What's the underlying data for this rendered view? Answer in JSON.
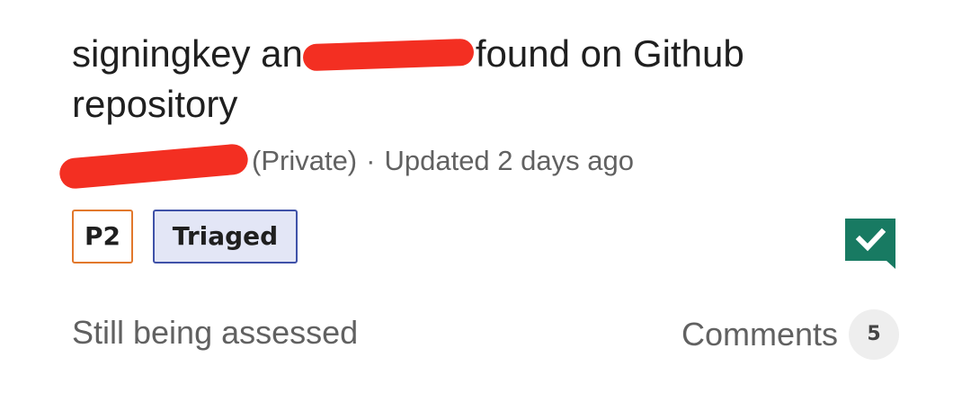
{
  "issue": {
    "title_start": "signingkey an",
    "title_end": "found on Github repository",
    "visibility": "(Private)",
    "separator": "·",
    "updated": "Updated 2 days ago",
    "priority": "P2",
    "status": "Triaged",
    "status_icon": "check-comment-icon",
    "status_icon_color": "#187a62",
    "assessment": "Still being assessed",
    "comments_label": "Comments",
    "comments_count": "5"
  },
  "colors": {
    "priority_border": "#e2782c",
    "status_border": "#3f51a8",
    "status_fill": "#e3e6f6",
    "redaction": "#f32f22"
  }
}
